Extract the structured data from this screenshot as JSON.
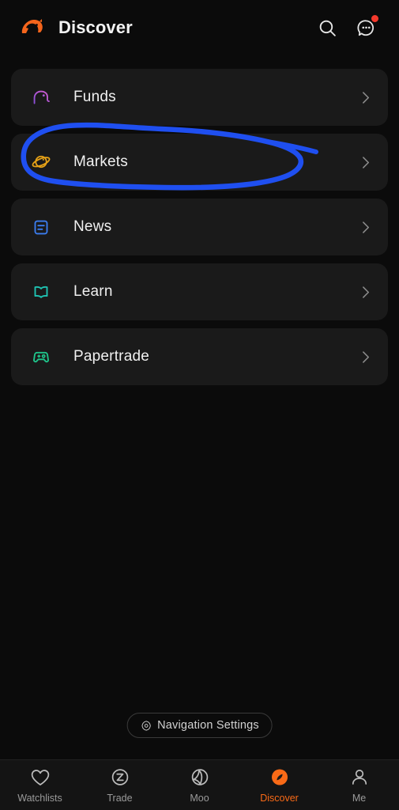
{
  "header": {
    "title": "Discover",
    "logo_icon": "moomoo-bull-logo",
    "logo_color": "#f5651c",
    "search_icon": "search-icon",
    "message_icon": "message-bubble-icon",
    "badge_visible": true,
    "badge_color": "#f5392c"
  },
  "menu": {
    "items": [
      {
        "label": "Funds",
        "icon": "elephant-icon",
        "icon_color": "#b060d8",
        "chevron": "›"
      },
      {
        "label": "Markets",
        "icon": "planet-icon",
        "icon_color": "#e8a317",
        "chevron": "›"
      },
      {
        "label": "News",
        "icon": "document-icon",
        "icon_color": "#3b7df0",
        "chevron": "›"
      },
      {
        "label": "Learn",
        "icon": "open-book-icon",
        "icon_color": "#1fc4b3",
        "chevron": "›"
      },
      {
        "label": "Papertrade",
        "icon": "gamepad-icon",
        "icon_color": "#1fc48a",
        "chevron": "›"
      }
    ]
  },
  "annotation": {
    "type": "hand-drawn-ellipse",
    "color": "#1f4ff0",
    "target": "Markets"
  },
  "nav_settings": {
    "label": "Navigation Settings",
    "icon": "gear-icon"
  },
  "bottom_nav": {
    "active_color": "#f96a17",
    "inactive_color": "#9a9a9a",
    "items": [
      {
        "label": "Watchlists",
        "icon": "heart-icon",
        "active": false
      },
      {
        "label": "Trade",
        "icon": "trade-z-icon",
        "active": false
      },
      {
        "label": "Moo",
        "icon": "moo-moon-icon",
        "active": false
      },
      {
        "label": "Discover",
        "icon": "compass-icon",
        "active": true
      },
      {
        "label": "Me",
        "icon": "person-icon",
        "active": false
      }
    ]
  }
}
